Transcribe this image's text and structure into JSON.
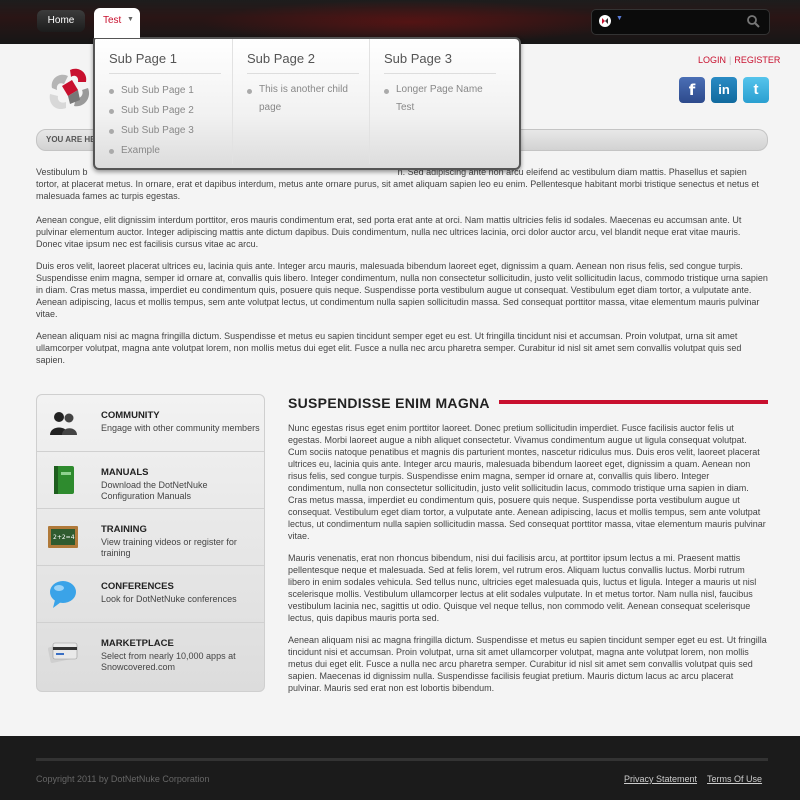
{
  "nav": {
    "home_label": "Home",
    "test_label": "Test",
    "search": {
      "placeholder": ""
    }
  },
  "dropdown": {
    "columns": [
      {
        "title": "Sub Page 1",
        "items": [
          "Sub Sub Page 1",
          "Sub Sub Page 2",
          "Sub Sub Page 3",
          "Example"
        ]
      },
      {
        "title": "Sub Page 2",
        "items": [
          "This is another child page"
        ]
      },
      {
        "title": "Sub Page 3",
        "items": [
          "Longer Page Name Test"
        ]
      }
    ]
  },
  "header": {
    "login_label": "LOGIN",
    "register_label": "REGISTER",
    "breadcrumb_label": "YOU ARE HE"
  },
  "intro": {
    "paragraphs": [
      "Vestibulum b                                                                                                                            n. Sed adipiscing ante non arcu eleifend ac vestibulum diam mattis. Phasellus et sapien tortor, at placerat metus. In ornare, erat et dapibus interdum, metus ante ornare purus, sit amet aliquam sapien leo eu enim. Pellentesque habitant morbi tristique senectus et netus et malesuada fames ac turpis egestas.",
      "Aenean congue, elit dignissim interdum porttitor, eros mauris condimentum erat, sed porta erat ante at orci. Nam mattis ultricies felis id sodales. Maecenas eu accumsan ante. Ut pulvinar elementum auctor. Integer adipiscing mattis ante dictum dapibus. Duis condimentum, nulla nec ultrices lacinia, orci dolor auctor arcu, vel blandit neque erat vitae mauris. Donec vitae ipsum nec est facilisis cursus vitae ac arcu.",
      "Duis eros velit, laoreet placerat ultrices eu, lacinia quis ante. Integer arcu mauris, malesuada bibendum laoreet eget, dignissim a quam. Aenean non risus felis, sed congue turpis. Suspendisse enim magna, semper id ornare at, convallis quis libero. Integer condimentum, nulla non consectetur sollicitudin, justo velit sollicitudin lacus, commodo tristique urna sapien in diam. Cras metus massa, imperdiet eu condimentum quis, posuere quis neque. Suspendisse porta vestibulum augue ut consequat. Vestibulum eget diam tortor, a vulputate ante. Aenean adipiscing, lacus et mollis tempus, sem ante volutpat lectus, ut condimentum nulla sapien sollicitudin massa. Sed consequat porttitor massa, vitae elementum mauris pulvinar vitae.",
      "Aenean aliquam nisi ac magna fringilla dictum. Suspendisse et metus eu sapien tincidunt semper eget eu est. Ut fringilla tincidunt nisi et accumsan. Proin volutpat, urna sit amet ullamcorper volutpat, magna ante volutpat lorem, non mollis metus dui eget elit. Fusce a nulla nec arcu pharetra semper. Curabitur id nisl sit amet sem convallis volutpat quis sed sapien."
    ]
  },
  "sidebar": {
    "items": [
      {
        "title": "COMMUNITY",
        "desc": "Engage with other community members",
        "icon": "community-icon"
      },
      {
        "title": "MANUALS",
        "desc": "Download the DotNetNuke Configuration Manuals",
        "icon": "manual-book-icon"
      },
      {
        "title": "TRAINING",
        "desc": "View training videos or register for training",
        "icon": "chalkboard-icon"
      },
      {
        "title": "CONFERENCES",
        "desc": "Look for DotNetNuke conferences",
        "icon": "speech-bubble-icon"
      },
      {
        "title": "MARKETPLACE",
        "desc": "Select from nearly 10,000 apps at Snowcovered.com",
        "icon": "credit-card-icon"
      }
    ]
  },
  "section": {
    "title": "SUSPENDISSE ENIM MAGNA",
    "paragraphs": [
      "Nunc egestas risus eget enim porttitor laoreet. Donec pretium sollicitudin imperdiet. Fusce facilisis auctor felis ut egestas. Morbi laoreet augue a nibh aliquet consectetur. Vivamus condimentum augue ut ligula consequat volutpat. Cum sociis natoque penatibus et magnis dis parturient montes, nascetur ridiculus mus. Duis eros velit, laoreet placerat ultrices eu, lacinia quis ante. Integer arcu mauris, malesuada bibendum laoreet eget, dignissim a quam. Aenean non risus felis, sed congue turpis. Suspendisse enim magna, semper id ornare at, convallis quis libero. Integer condimentum, nulla non consectetur sollicitudin, justo velit sollicitudin lacus, commodo tristique urna sapien in diam. Cras metus massa, imperdiet eu condimentum quis, posuere quis neque. Suspendisse porta vestibulum augue ut consequat. Vestibulum eget diam tortor, a vulputate ante. Aenean adipiscing, lacus et mollis tempus, sem ante volutpat lectus, ut condimentum nulla sapien sollicitudin massa. Sed consequat porttitor massa, vitae elementum mauris pulvinar vitae.",
      "Mauris venenatis, erat non rhoncus bibendum, nisi dui facilisis arcu, at porttitor ipsum lectus a mi. Praesent mattis pellentesque neque et malesuada. Sed at felis lorem, vel rutrum eros. Aliquam luctus convallis luctus. Morbi rutrum libero in enim sodales vehicula. Sed tellus nunc, ultricies eget malesuada quis, luctus et ligula. Integer a mauris ut nisl scelerisque mollis. Vestibulum ullamcorper lectus at elit sodales vulputate. In et metus tortor. Nam nulla nisl, faucibus vestibulum lacinia nec, sagittis ut odio. Quisque vel neque tellus, non commodo velit. Aenean consequat scelerisque lectus, quis dapibus mauris porta sed.",
      "Aenean aliquam nisi ac magna fringilla dictum. Suspendisse et metus eu sapien tincidunt semper eget eu est. Ut fringilla tincidunt nisi et accumsan. Proin volutpat, urna sit amet ullamcorper volutpat, magna ante volutpat lorem, non mollis metus dui eget elit. Fusce a nulla nec arcu pharetra semper. Curabitur id nisl sit amet sem convallis volutpat quis sed sapien. Maecenas id dignissim nulla. Suspendisse facilisis feugiat pretium. Mauris dictum lacus ac arcu placerat pulvinar. Mauris sed erat non est lobortis bibendum."
    ]
  },
  "footer": {
    "copyright": "Copyright 2011 by DotNetNuke Corporation",
    "privacy_label": "Privacy Statement",
    "terms_label": "Terms Of Use"
  },
  "colors": {
    "accent": "#c8102e",
    "topbar": "#1d1d1d",
    "footer": "#1b1b1b"
  }
}
